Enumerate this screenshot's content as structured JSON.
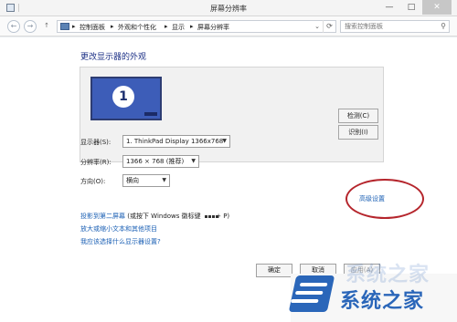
{
  "window": {
    "title": "屏幕分辨率",
    "min": "—",
    "max": "□",
    "close": "✕"
  },
  "address": {
    "back": "←",
    "forward": "→",
    "up": "↑",
    "separator": "▸",
    "breadcrumbs": [
      "控制面板",
      "外观和个性化",
      "显示",
      "屏幕分辨率"
    ],
    "dropdown": "⌄",
    "refresh": "⟳",
    "search_placeholder": "搜索控制面板",
    "search_icon": "⚲"
  },
  "main": {
    "heading": "更改显示器的外观",
    "monitor_number": "1",
    "detect_label": "检测(C)",
    "identify_label": "识别(I)",
    "display_label": "显示器(S):",
    "display_value": "1. ThinkPad Display 1366x768",
    "resolution_label": "分辨率(R):",
    "resolution_value": "1366 × 768 (推荐)",
    "orientation_label": "方向(O):",
    "orientation_value": "横向",
    "advanced_link": "高级设置",
    "project_link": "投影到第二屏幕",
    "project_hint_before": " (或按下 Windows 徽标键 ",
    "project_hint_after": " + P)",
    "text_size_link": "放大或缩小文本和其他项目",
    "which_settings_link": "我应该选择什么显示器设置?",
    "ok": "确定",
    "cancel": "取消",
    "apply": "应用(A)"
  },
  "watermark": {
    "text": "系统之家"
  },
  "colors": {
    "link": "#1a5fb4",
    "annotation": "#b5252c",
    "monitor": "#3d5db8"
  }
}
